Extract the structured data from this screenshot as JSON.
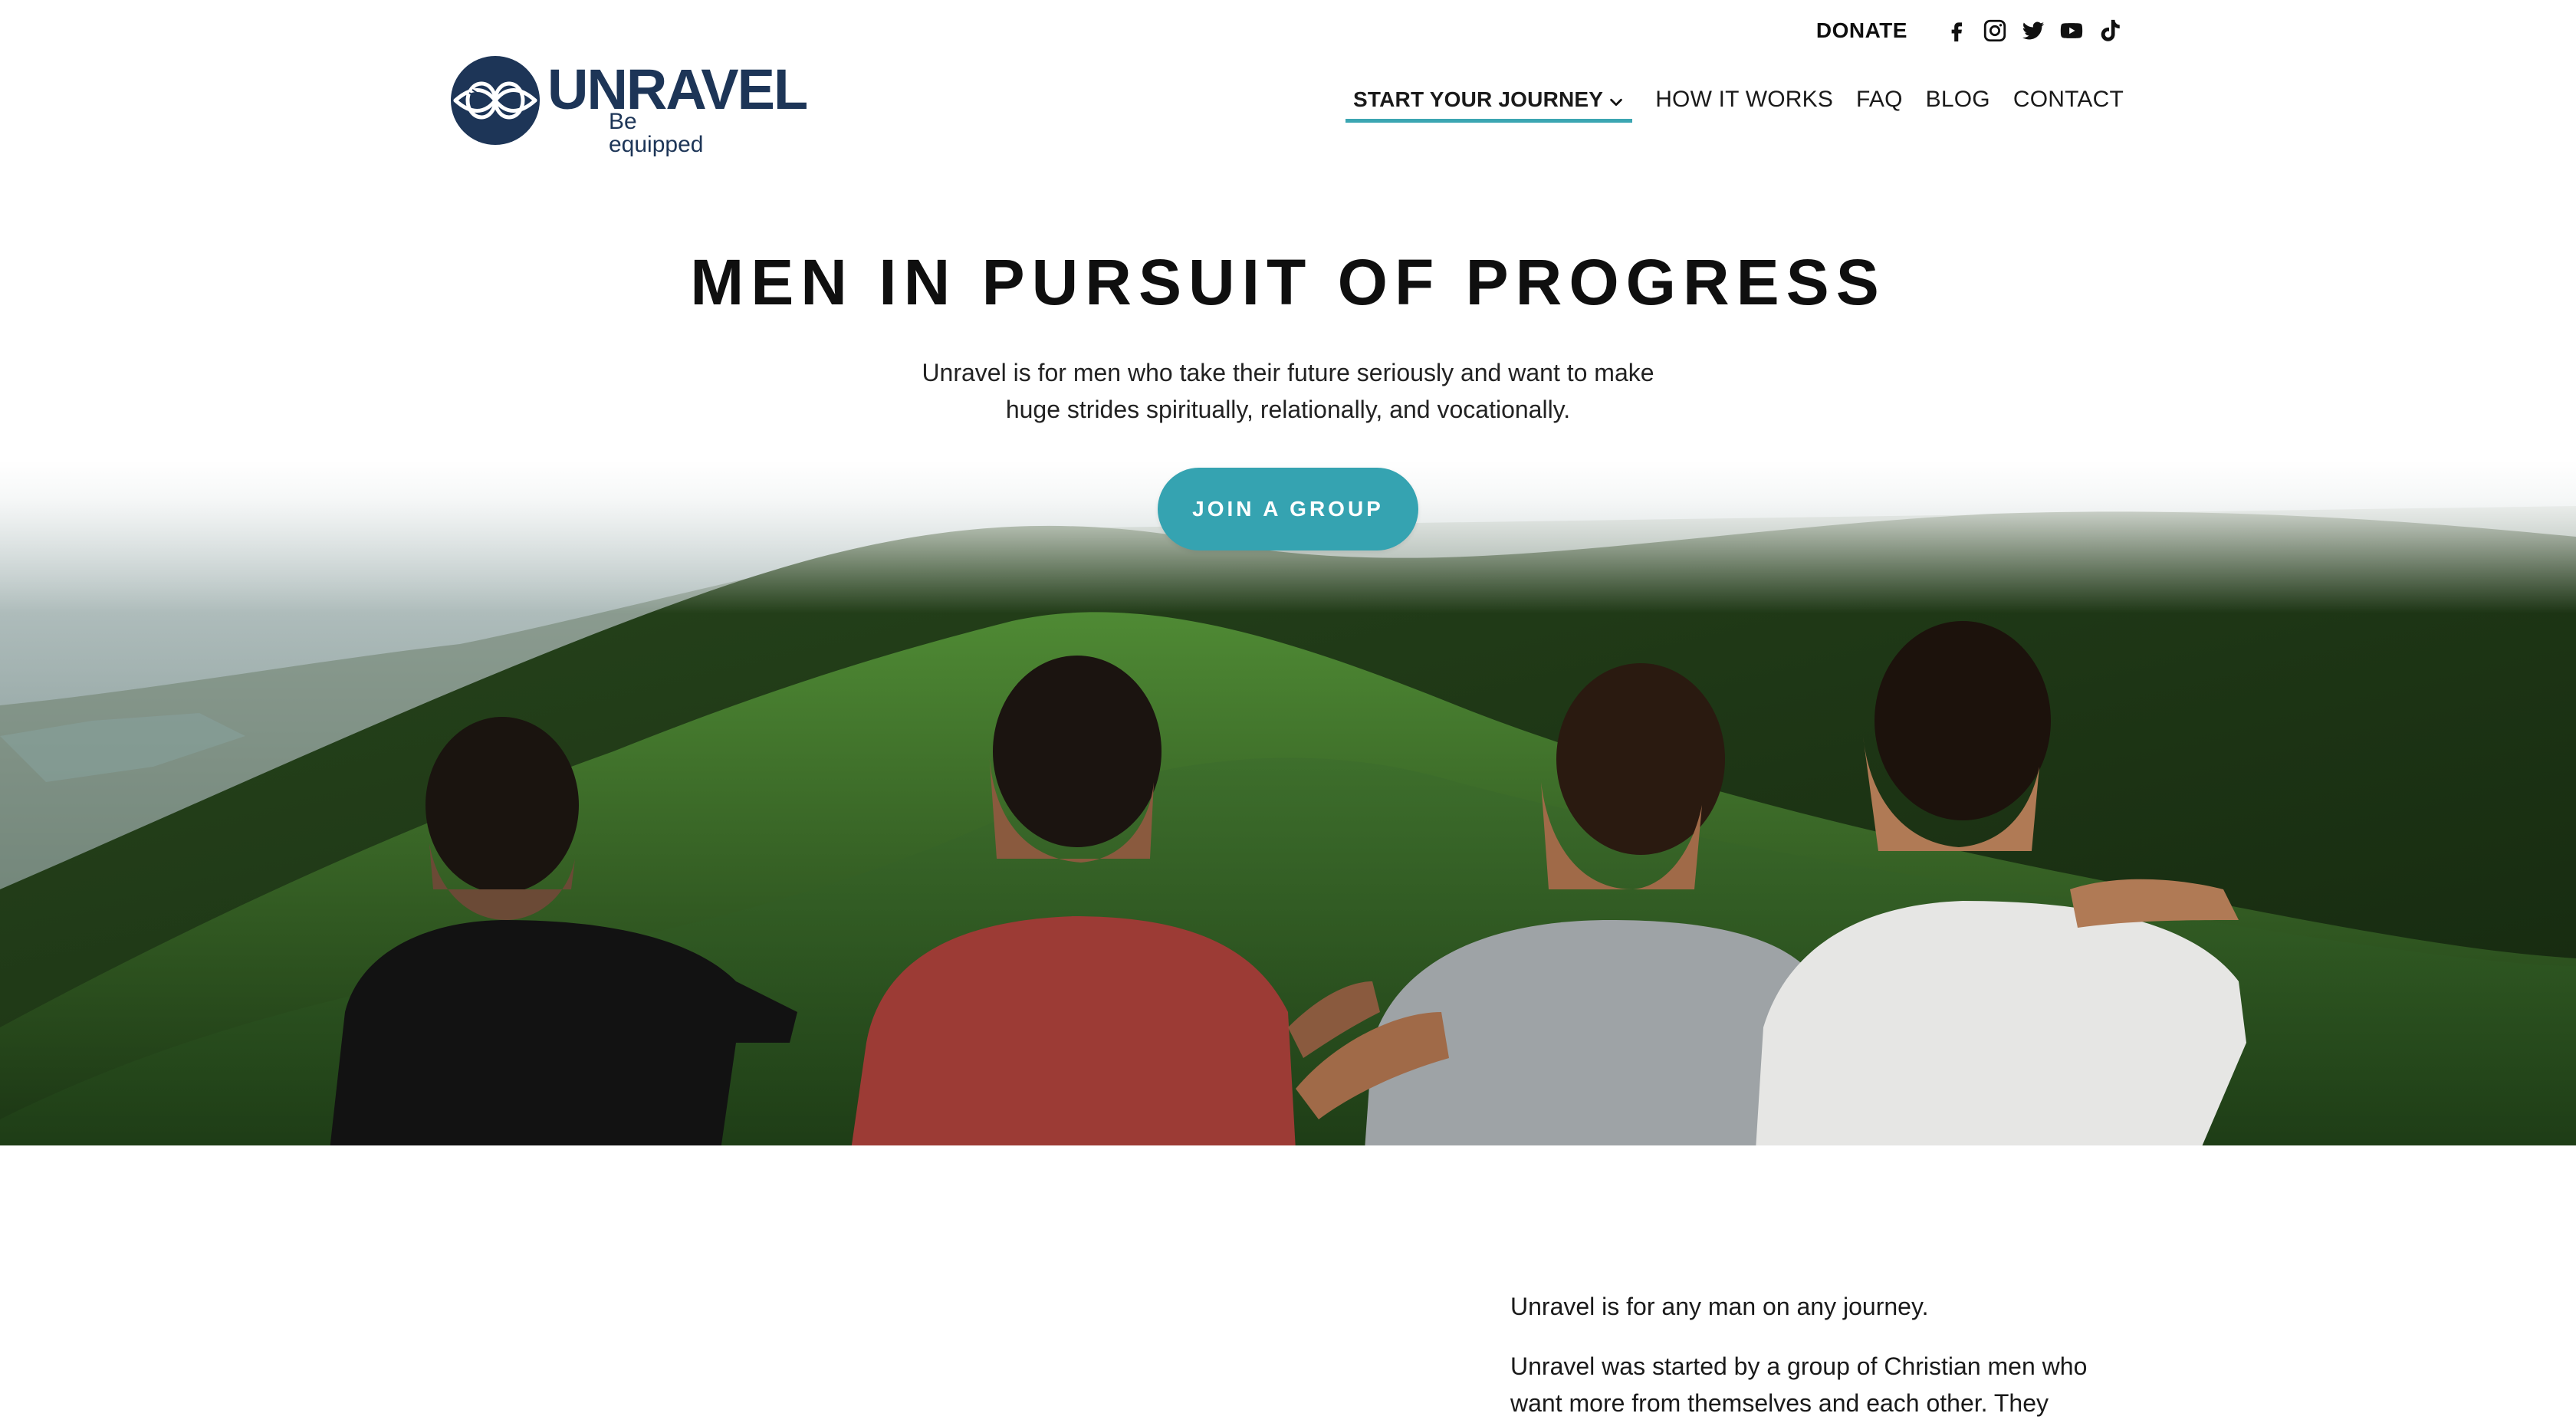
{
  "header": {
    "donate_label": "DONATE",
    "social_icons": [
      "facebook-icon",
      "instagram-icon",
      "twitter-icon",
      "youtube-icon",
      "tiktok-icon"
    ],
    "logo": {
      "wordmark": "UNRAVEL",
      "tagline": "Be equipped"
    },
    "nav": [
      {
        "label": "START YOUR JOURNEY",
        "active": true,
        "has_dropdown": true
      },
      {
        "label": "HOW IT WORKS"
      },
      {
        "label": "FAQ"
      },
      {
        "label": "BLOG"
      },
      {
        "label": "CONTACT"
      }
    ]
  },
  "hero": {
    "title_prefix": "MEN IN PURSUIT OF ",
    "title_highlight": "PROGRESS",
    "subtitle": "Unravel is for men who take their future seriously and want to make huge strides spiritually, relationally, and vocationally.",
    "cta_label": "JOIN A GROUP"
  },
  "about": {
    "paragraphs": [
      "Unravel is for any man on any journey.",
      "Unravel was started by a group of Christian men who want more from themselves and each other. They"
    ]
  },
  "colors": {
    "accent": "#3ba6b2",
    "brand_navy": "#1d3557",
    "text": "#111111"
  }
}
